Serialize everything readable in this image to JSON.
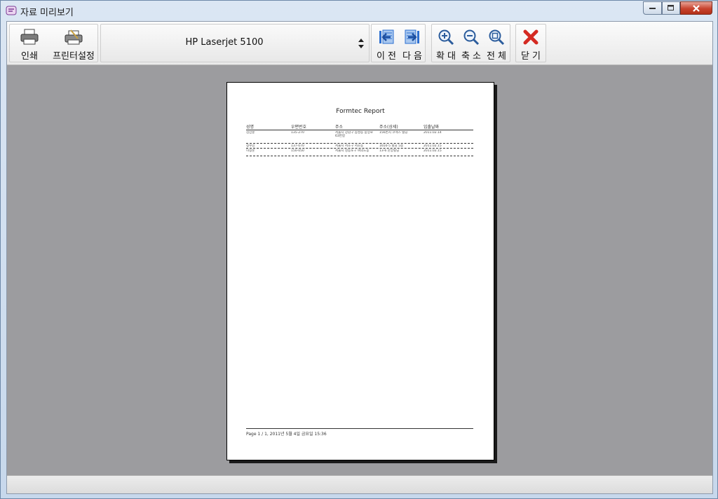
{
  "window": {
    "title": "자료 미리보기"
  },
  "toolbar": {
    "print_label": "인쇄",
    "printer_settings_label": "프린터설정",
    "printer_selected": "HP Laserjet 5100",
    "prev_label": "이 전",
    "next_label": "다 음",
    "zoom_in_label": "확 대",
    "zoom_out_label": "축 소",
    "fit_all_label": "전 체",
    "close_label": "닫 기"
  },
  "report": {
    "title": "Formtec Report",
    "columns": [
      "성명",
      "우편번호",
      "주소",
      "주소(상세)",
      "입출날짜"
    ],
    "rows": [
      [
        "김민준",
        "135-270",
        "서울시 강남구 삼성동 중앙로63번길",
        "156번지 코엑스 빌딩",
        "2011.02.14"
      ],
      [
        "정수민",
        "137-070",
        "서울시 서초구 서초동",
        "1650-5 빌딩 5층",
        "2011.02.15"
      ],
      [
        "이정훈",
        "150-050",
        "서울시 영등포구 여의도동",
        "13-6 한양빌딩",
        "2011.02.15"
      ]
    ],
    "footer": "Page 1 / 1,   2011년 5월 4일 금요일   15:36"
  },
  "colors": {
    "preview_bg": "#9c9c9f",
    "close_red": "#d42a22",
    "nav_blue": "#2d6fd0"
  }
}
